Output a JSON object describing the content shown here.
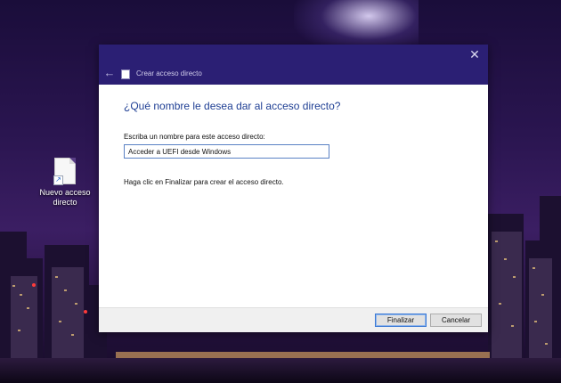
{
  "desktop": {
    "icon_label": "Nuevo acceso directo"
  },
  "dialog": {
    "title": "Crear acceso directo",
    "heading": "¿Qué nombre le desea dar al acceso directo?",
    "field_label": "Escriba un nombre para este acceso directo:",
    "field_value": "Acceder a UEFI desde Windows",
    "hint": "Haga clic en Finalizar para crear el acceso directo.",
    "finish_label": "Finalizar",
    "cancel_label": "Cancelar",
    "close_glyph": "✕",
    "back_glyph": "←"
  },
  "colors": {
    "titlebar": "#2b1f74",
    "heading": "#1f3f94",
    "input_border": "#5a81c4"
  },
  "icons": [
    "back-arrow-icon",
    "close-icon",
    "shortcut-file-icon",
    "shortcut-arrow-icon"
  ]
}
